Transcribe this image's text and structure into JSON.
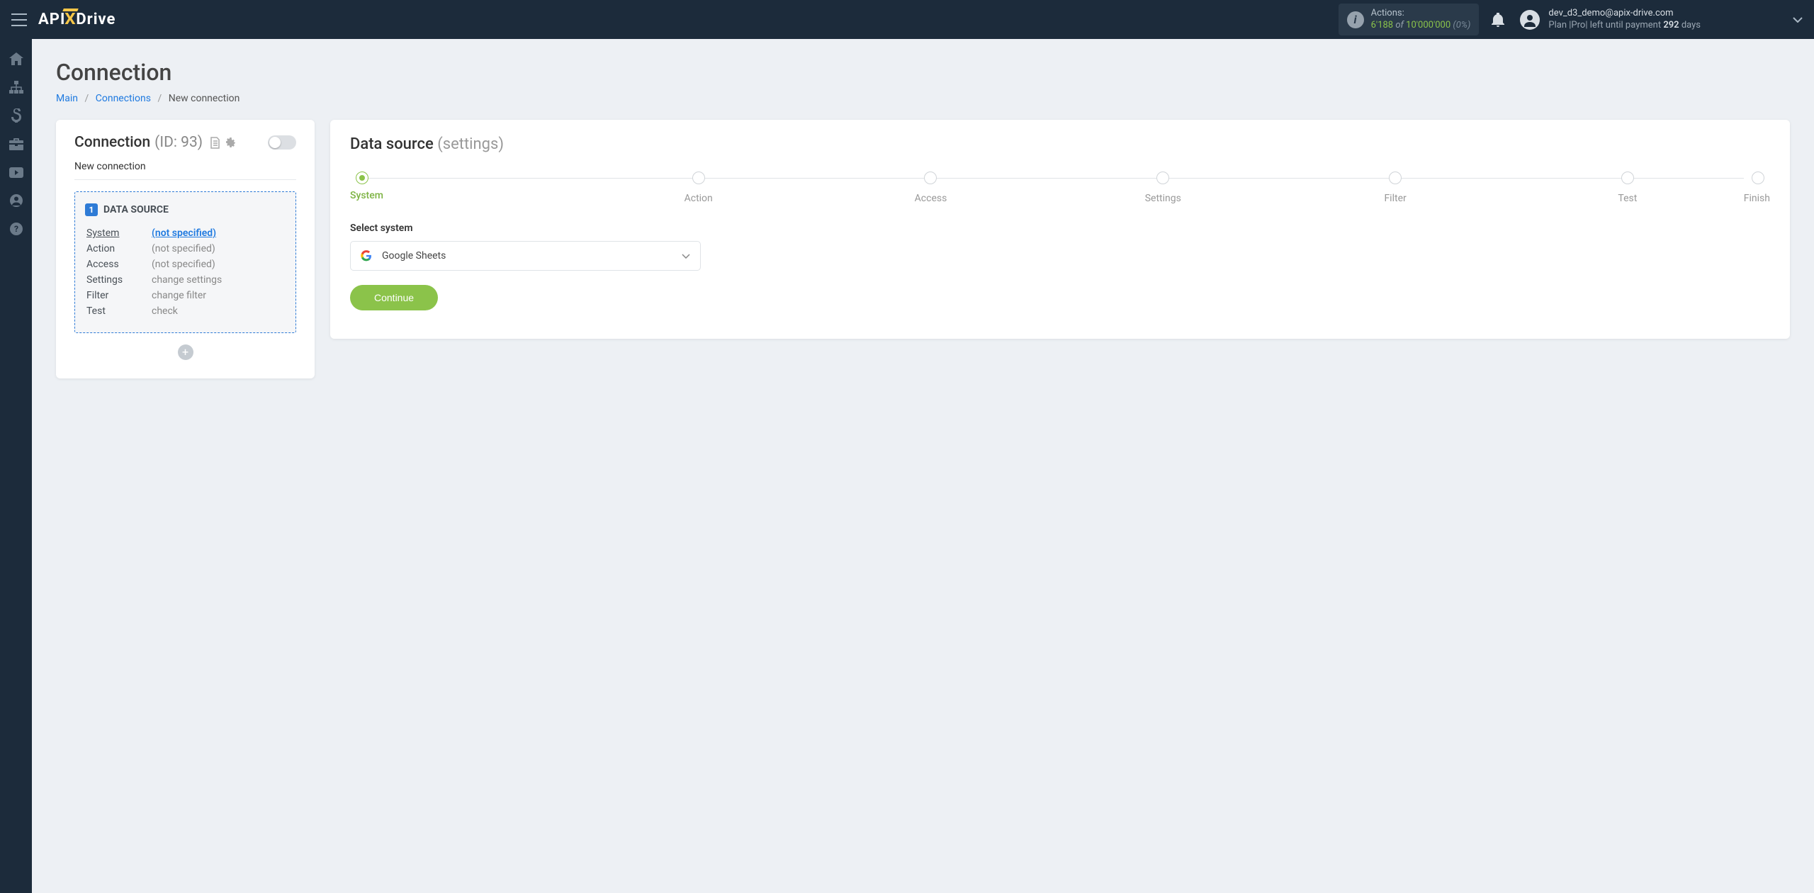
{
  "header": {
    "logo_part1": "API",
    "logo_part2": "Drive",
    "actions_label": "Actions:",
    "actions_count": "6'188",
    "actions_of": "of",
    "actions_total": "10'000'000",
    "actions_pct": "(0%)",
    "user_email": "dev_d3_demo@apix-drive.com",
    "plan_prefix": "Plan |Pro| left until payment ",
    "plan_days": "292",
    "plan_suffix": " days"
  },
  "page": {
    "title": "Connection",
    "breadcrumb": {
      "main": "Main",
      "connections": "Connections",
      "current": "New connection"
    }
  },
  "left": {
    "title": "Connection",
    "id_label": "(ID: 93)",
    "name": "New connection",
    "ds_badge": "1",
    "ds_title": "DATA SOURCE",
    "rows": {
      "system_label": "System",
      "system_value": "(not specified)",
      "action_label": "Action",
      "action_value": "(not specified)",
      "access_label": "Access",
      "access_value": "(not specified)",
      "settings_label": "Settings",
      "settings_value": "change settings",
      "filter_label": "Filter",
      "filter_value": "change filter",
      "test_label": "Test",
      "test_value": "check"
    }
  },
  "right": {
    "title": "Data source",
    "subtitle": "(settings)",
    "steps": [
      "System",
      "Action",
      "Access",
      "Settings",
      "Filter",
      "Test",
      "Finish"
    ],
    "active_step": 0,
    "select_label": "Select system",
    "select_value": "Google Sheets",
    "continue_label": "Continue"
  }
}
